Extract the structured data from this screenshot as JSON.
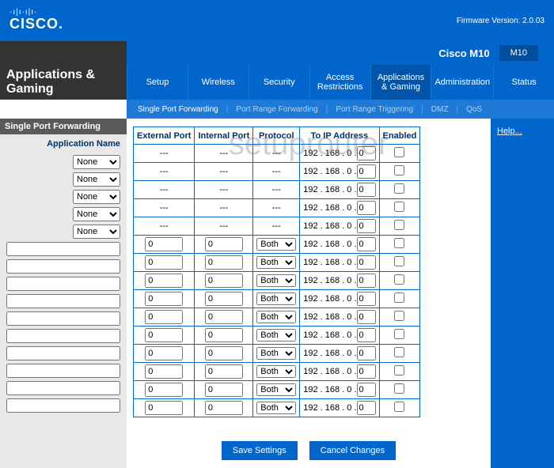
{
  "header": {
    "logo_text": "CISCO.",
    "firmware_label": "Firmware Version: 2.0.03"
  },
  "title": {
    "model_name": "Cisco M10",
    "model_num": "M10",
    "page_heading": "Applications & Gaming"
  },
  "tabs": [
    "Setup",
    "Wireless",
    "Security",
    "Access Restrictions",
    "Applications & Gaming",
    "Administration",
    "Status"
  ],
  "subnav": {
    "items": [
      "Single Port Forwarding",
      "Port Range Forwarding",
      "Port Range Triggering",
      "DMZ",
      "QoS"
    ]
  },
  "sidebar": {
    "section_title": "Single Port Forwarding",
    "label": "Application Name",
    "preset_option": "None",
    "preset_rows": 5,
    "text_rows": 10
  },
  "table": {
    "headers": [
      "External Port",
      "Internal Port",
      "Protocol",
      "To IP Address",
      "Enabled"
    ],
    "dash": "---",
    "fixed_rows": 5,
    "edit_rows": 10,
    "port_default": "0",
    "protocol_option": "Both",
    "ip_prefix": "192 . 168 . 0 .",
    "ip_last": "0"
  },
  "help": "Help...",
  "buttons": {
    "save": "Save Settings",
    "cancel": "Cancel Changes"
  },
  "watermark": "setuprouter"
}
